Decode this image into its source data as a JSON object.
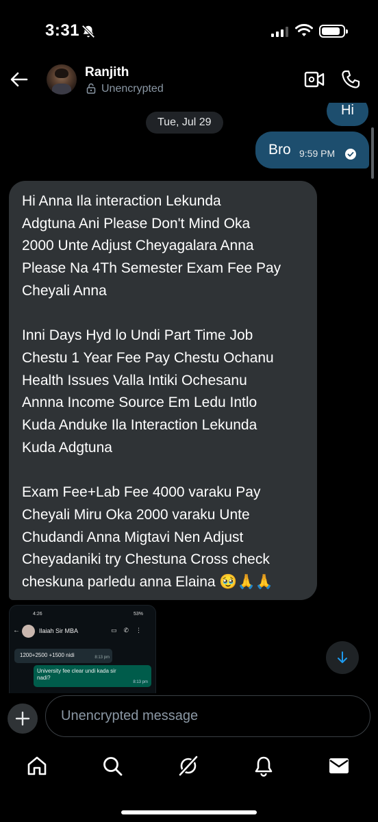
{
  "status_bar": {
    "time": "3:31"
  },
  "header": {
    "contact_name": "Ranjith",
    "encryption_status": "Unencrypted"
  },
  "chat": {
    "messages_top": [
      {
        "text": "Hi",
        "direction": "outgoing"
      }
    ],
    "date_separator": "Tue, Jul 29",
    "outgoing_message": {
      "text": "Bro",
      "time": "9:59 PM"
    },
    "incoming_message": {
      "text": "Hi Anna Ila interaction Lekunda\nAdgtuna Ani Please Don't Mind Oka\n2000 Unte Adjust Cheyagalara Anna\nPlease Na 4Th Semester Exam Fee Pay\nCheyali Anna\n\nInni Days Hyd lo Undi Part Time Job\nChestu 1 Year Fee Pay Chestu Ochanu\nHealth Issues Valla Intiki Ochesanu\nAnnna Income Source Em Ledu Intlo\nKuda Anduke Ila Interaction Lekunda\nKuda Adgtuna\n\nExam Fee+Lab Fee 4000 varaku Pay\nCheyali Miru Oka 2000 varaku Unte\nChudandi Anna Migtavi Nen Adjust\nCheyadaniki try Chestuna Cross check\ncheskuna parledu anna Elaina 🥹🙏🙏"
    },
    "attached_screenshot": {
      "status_time": "4:26",
      "status_right": "53%",
      "contact_name": "Ilaiah Sir MBA",
      "incoming_text": "1200+2500 +1500 nidi",
      "incoming_time": "8:13 pm",
      "outgoing_text": "University fee clear undi kada sir nadi?",
      "outgoing_time": "8:13 pm"
    }
  },
  "composer": {
    "placeholder": "Unencrypted message"
  },
  "nav": {
    "items": [
      "home-icon",
      "search-icon",
      "grok-icon",
      "notifications-icon",
      "messages-icon"
    ]
  },
  "colors": {
    "background": "#000000",
    "outgoing_bubble": "#1d4e6e",
    "incoming_bubble": "#2f3336",
    "secondary_text": "#8b98a5"
  }
}
